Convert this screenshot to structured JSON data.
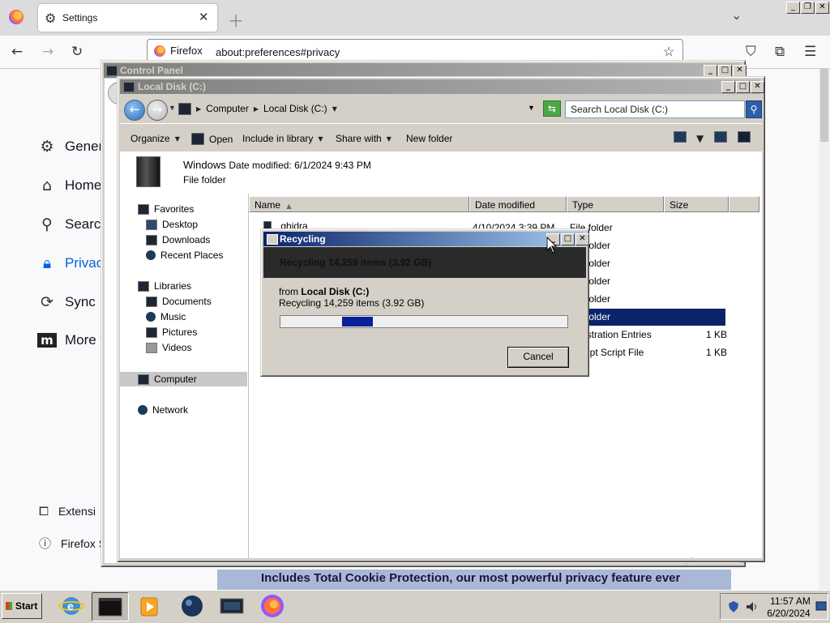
{
  "firefox": {
    "tab_title": "Settings",
    "url_identity": "Firefox",
    "url": "about:preferences#privacy",
    "categories": [
      {
        "label": "General",
        "icon": "gear-icon"
      },
      {
        "label": "Home",
        "icon": "home-icon"
      },
      {
        "label": "Search",
        "icon": "search-icon"
      },
      {
        "label": "Privacy",
        "icon": "lock-icon"
      },
      {
        "label": "Sync",
        "icon": "sync-icon"
      },
      {
        "label": "More f",
        "icon": "mozilla-icon"
      }
    ],
    "footer": [
      "Extensi",
      "Firefox Su"
    ],
    "banner": "Includes Total Cookie Protection, our most powerful privacy feature ever",
    "accent_color": "#0061e0"
  },
  "control_panel": {
    "title": "Control Panel"
  },
  "explorer": {
    "title": "Local Disk (C:)",
    "breadcrumb": [
      "Computer",
      "Local Disk (C:)"
    ],
    "search_placeholder": "Search Local Disk (C:)",
    "commands": [
      "Organize",
      "Open",
      "Include in library",
      "Share with",
      "New folder"
    ],
    "details": {
      "name": "Windows",
      "modified": "Date modified: 6/1/2024 9:43 PM",
      "type": "File folder"
    },
    "nav": {
      "favorites": "Favorites",
      "favorites_items": [
        "Desktop",
        "Downloads",
        "Recent Places"
      ],
      "libraries": "Libraries",
      "libraries_items": [
        "Documents",
        "Music",
        "Pictures",
        "Videos"
      ],
      "computer": "Computer",
      "network": "Network"
    },
    "columns": [
      "Name",
      "Date modified",
      "Type",
      "Size"
    ],
    "rows": [
      {
        "name": "ghidra",
        "date": "4/10/2024 3:39 PM",
        "type": "File folder",
        "size": ""
      },
      {
        "name": "",
        "date": "",
        "type": "folder",
        "size": ""
      },
      {
        "name": "",
        "date": "",
        "type": "folder",
        "size": ""
      },
      {
        "name": "",
        "date": "",
        "type": "folder",
        "size": ""
      },
      {
        "name": "",
        "date": "",
        "type": "folder",
        "size": ""
      },
      {
        "name": "",
        "date": "",
        "type": "folder",
        "size": ""
      },
      {
        "name": "",
        "date": "",
        "type": "istration Entries",
        "size": "1 KB"
      },
      {
        "name": "",
        "date": "",
        "type": "ript Script File",
        "size": "1 KB"
      }
    ]
  },
  "recycling": {
    "title": "Recycling",
    "header": "Recycling 14,259 items (3.92 GB)",
    "from_label": "from",
    "from_source": "Local Disk (C:)",
    "detail": "Recycling 14,259 items (3.92 GB)",
    "cancel_label": "Cancel",
    "progress_color": "#0a1f9a"
  },
  "taskbar": {
    "start_label": "Start",
    "apps": [
      "internet-explorer-icon",
      "explorer-icon",
      "media-player-icon",
      "network-globe-icon",
      "control-panel-icon",
      "firefox-icon"
    ],
    "time": "11:57 AM",
    "date": "6/20/2024"
  }
}
